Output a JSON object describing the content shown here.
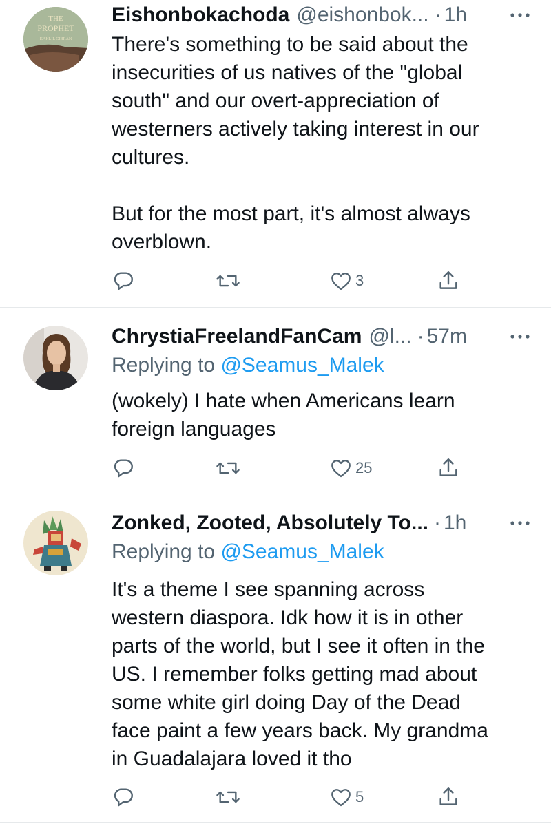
{
  "tweets": [
    {
      "name": "Eishonbokachoda",
      "handle": "@eishonbok...",
      "dot": "·",
      "time": "1h",
      "avatar_text_line1": "THE",
      "avatar_text_line2": "PROPHET",
      "avatar_text_line3": "KAHLIL GIBRAN",
      "body": "There's something to be said about the\ninsecurities of us natives of the \"global\nsouth\" and our overt-appreciation of\nwesterners actively taking interest in our\ncultures.\n\nBut for the most part, it's almost always\noverblown.",
      "likes": "3"
    },
    {
      "name": "ChrystiaFreelandFanCam",
      "handle": "@l...",
      "dot": "·",
      "time": "57m",
      "replying_prefix": "Replying to ",
      "replying_to": "@Seamus_Malek",
      "body": "(wokely) I hate when Americans learn\nforeign languages",
      "likes": "25"
    },
    {
      "name": "Zonked, Zooted, Absolutely To...",
      "dot": "·",
      "time": "1h",
      "replying_prefix": "Replying to ",
      "replying_to": "@Seamus_Malek",
      "body": "It's a theme I see spanning across\nwestern diaspora. Idk how it is in other\nparts of the world, but I see it often in the\nUS. I remember folks getting mad about\nsome white girl doing Day of the Dead\nface paint a few years back. My grandma\nin Guadalajara loved it tho",
      "likes": "5"
    }
  ],
  "icons": {
    "reply": "reply-icon",
    "retweet": "retweet-icon",
    "like": "heart-icon",
    "share": "share-icon",
    "more": "more-icon"
  },
  "colors": {
    "text": "#0f1419",
    "secondary": "#536471",
    "link": "#1d9bf0",
    "divider": "#e6e9eb"
  }
}
